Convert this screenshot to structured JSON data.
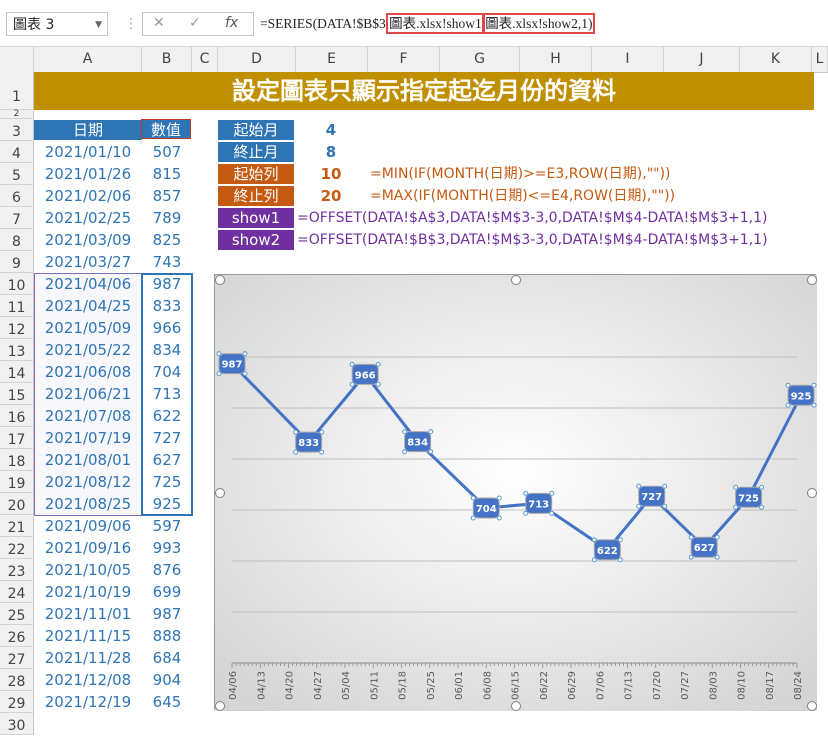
{
  "name_box": "圖表 3",
  "formula_bar": {
    "prefix": "=SERIES(DATA!$B$3,",
    "part1": "圖表.xlsx!show1",
    "sep": ",",
    "part2": "圖表.xlsx!show2,1)"
  },
  "columns": [
    "A",
    "B",
    "C",
    "D",
    "E",
    "F",
    "G",
    "H",
    "I",
    "J",
    "K",
    "L"
  ],
  "rows": [
    "1",
    "2",
    "3",
    "4",
    "5",
    "6",
    "7",
    "8",
    "9",
    "10",
    "11",
    "12",
    "13",
    "14",
    "15",
    "16",
    "17",
    "18",
    "19",
    "20",
    "21",
    "22",
    "23",
    "24",
    "25",
    "26",
    "27",
    "28",
    "29",
    "30"
  ],
  "title": "設定圖表只顯示指定起迄月份的資料",
  "table": {
    "header_date": "日期",
    "header_value": "數值",
    "dates": [
      "2021/01/10",
      "2021/01/26",
      "2021/02/06",
      "2021/02/25",
      "2021/03/09",
      "2021/03/27",
      "2021/04/06",
      "2021/04/25",
      "2021/05/09",
      "2021/05/22",
      "2021/06/08",
      "2021/06/21",
      "2021/07/08",
      "2021/07/19",
      "2021/08/01",
      "2021/08/12",
      "2021/08/25",
      "2021/09/06",
      "2021/09/16",
      "2021/10/05",
      "2021/10/19",
      "2021/11/01",
      "2021/11/15",
      "2021/11/28",
      "2021/12/08",
      "2021/12/19"
    ],
    "values": [
      "507",
      "815",
      "857",
      "789",
      "825",
      "743",
      "987",
      "833",
      "966",
      "834",
      "704",
      "713",
      "622",
      "727",
      "627",
      "725",
      "925",
      "597",
      "993",
      "876",
      "699",
      "987",
      "888",
      "684",
      "904",
      "645"
    ]
  },
  "params": [
    {
      "label": "起始月",
      "value": "4",
      "formula": ""
    },
    {
      "label": "終止月",
      "value": "8",
      "formula": ""
    },
    {
      "label": "起始列",
      "value": "10",
      "formula": "=MIN(IF(MONTH(日期)>=E3,ROW(日期),\"\"))"
    },
    {
      "label": "終止列",
      "value": "20",
      "formula": "=MAX(IF(MONTH(日期)<=E4,ROW(日期),\"\"))"
    },
    {
      "label": "show1",
      "value": "",
      "formula": "=OFFSET(DATA!$A$3,DATA!$M$3-3,0,DATA!$M$4-DATA!$M$3+1,1)"
    },
    {
      "label": "show2",
      "value": "",
      "formula": "=OFFSET(DATA!$B$3,DATA!$M$3-3,0,DATA!$M$4-DATA!$M$3+1,1)"
    }
  ],
  "colors": {
    "title_bg": "#bf8f00",
    "blue": "#2e75b6",
    "orange": "#c55a11",
    "purple": "#7030a0",
    "line": "#4472c4"
  },
  "chart_data": {
    "type": "line",
    "x_ticks": [
      "04/06",
      "04/13",
      "04/20",
      "04/27",
      "05/04",
      "05/11",
      "05/18",
      "05/25",
      "06/01",
      "06/08",
      "06/15",
      "06/22",
      "06/29",
      "07/06",
      "07/13",
      "07/20",
      "07/27",
      "08/03",
      "08/10",
      "08/17",
      "08/24"
    ],
    "x": [
      "04/06",
      "04/25",
      "05/09",
      "05/22",
      "06/08",
      "06/21",
      "07/08",
      "07/19",
      "08/01",
      "08/12",
      "08/25"
    ],
    "day_index": [
      0,
      19,
      33,
      46,
      63,
      76,
      93,
      104,
      117,
      128,
      141
    ],
    "values": [
      987,
      833,
      966,
      834,
      704,
      713,
      622,
      727,
      627,
      725,
      925
    ],
    "ylim": [
      400,
      1000
    ],
    "grid": true
  }
}
